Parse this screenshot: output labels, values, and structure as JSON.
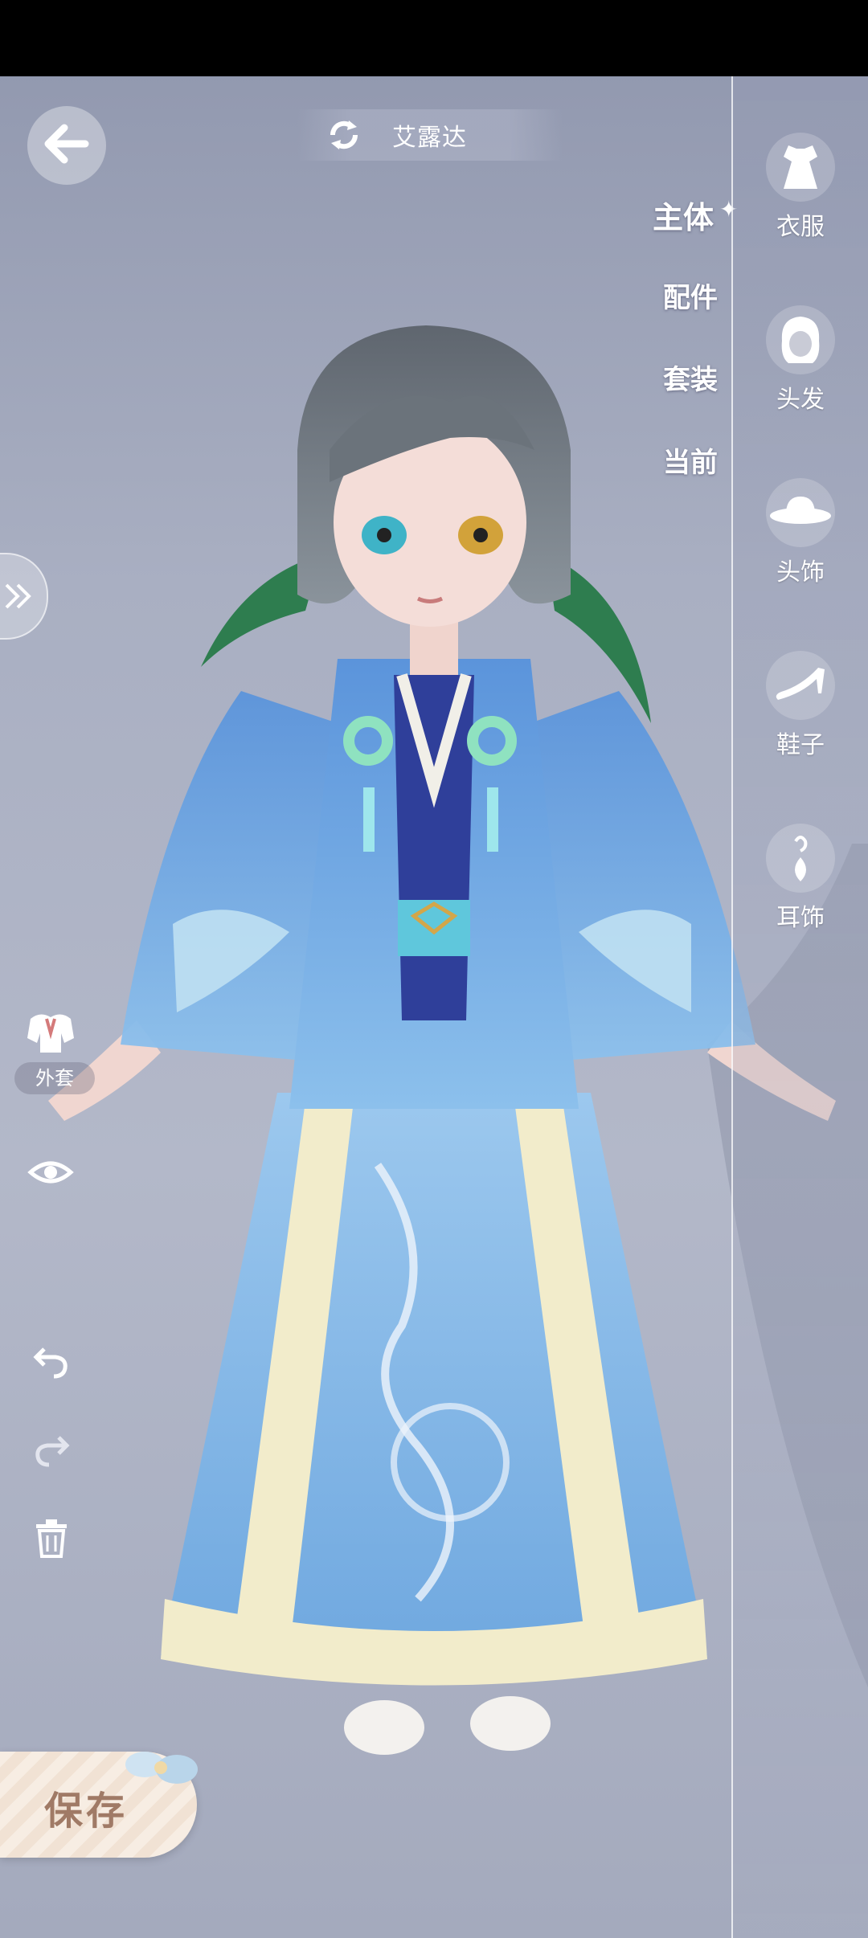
{
  "header": {
    "character_name": "艾露达"
  },
  "tabs": [
    {
      "label": "主体",
      "active": true
    },
    {
      "label": "配件",
      "active": false
    },
    {
      "label": "套装",
      "active": false
    },
    {
      "label": "当前",
      "active": false
    }
  ],
  "categories": [
    {
      "label": "衣服",
      "icon": "dress-icon"
    },
    {
      "label": "头发",
      "icon": "hair-icon"
    },
    {
      "label": "头饰",
      "icon": "hat-icon"
    },
    {
      "label": "鞋子",
      "icon": "shoe-icon"
    },
    {
      "label": "耳饰",
      "icon": "earring-icon"
    }
  ],
  "tools": {
    "coat_label": "外套"
  },
  "actions": {
    "save_label": "保存"
  },
  "colors": {
    "outfit_blue": "#6aa4dd",
    "skirt_cream": "#f2eccb",
    "hair": "#707880"
  }
}
